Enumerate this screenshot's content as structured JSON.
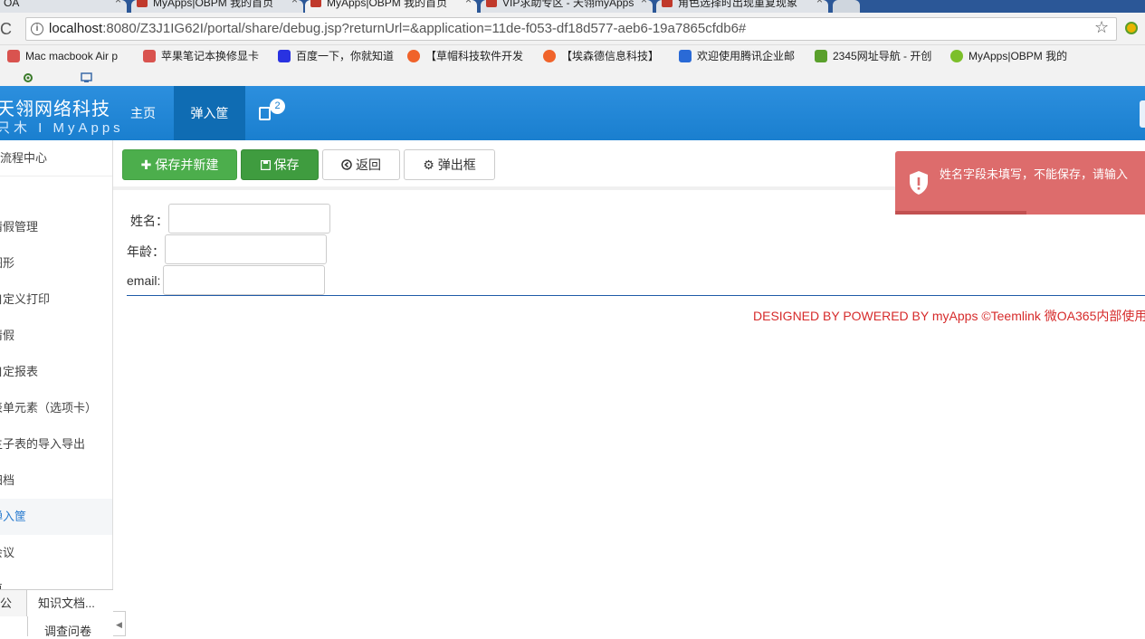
{
  "browser": {
    "tabs": [
      {
        "label": "OA",
        "close": "×"
      },
      {
        "label": "MyApps|OBPM 我的首页",
        "close": "×"
      },
      {
        "label": "MyApps|OBPM 我的首页",
        "close": "×"
      },
      {
        "label": "VIP求助专区 - 天翎myApps",
        "close": "×"
      },
      {
        "label": "角色选择时出现重复现象",
        "close": "×"
      }
    ],
    "url_host": "localhost",
    "url_rest": ":8080/Z3J1IG62I/portal/share/debug.jsp?returnUrl=&application=11de-f053-df18d577-aeb6-19a7865cfdb6#",
    "reload_glyph": "C",
    "info_glyph": "i",
    "star_glyph": "☆",
    "bookmarks": [
      {
        "label": "Mac macbook Air p",
        "color": "#d9534f"
      },
      {
        "label": "苹果笔记本换修显卡",
        "color": "#d9534f"
      },
      {
        "label": "百度一下，你就知道",
        "color": "#2932e1"
      },
      {
        "label": "【草帽科技软件开发",
        "color": "#f0632a"
      },
      {
        "label": "【埃森德信息科技】",
        "color": "#f0632a"
      },
      {
        "label": "欢迎使用腾讯企业邮",
        "color": "#2a6ad6"
      },
      {
        "label": "2345网址导航 - 开创",
        "color": "#5aa02c"
      },
      {
        "label": "MyApps|OBPM 我的",
        "color": "#7cbf2a"
      }
    ]
  },
  "header": {
    "brand": "天翎网络科技",
    "brand_sub": "只木 I MyApps",
    "nav_home": "主页",
    "nav_popup": "弹入筐",
    "msg_badge": "2"
  },
  "sidebar": {
    "items": [
      {
        "label": "流程中心",
        "active": false
      },
      {
        "label": "",
        "active": false
      },
      {
        "label": "请假管理",
        "active": false
      },
      {
        "label": "图形",
        "active": false
      },
      {
        "label": "自定义打印",
        "active": false
      },
      {
        "label": "请假",
        "active": false
      },
      {
        "label": "自定报表",
        "active": false
      },
      {
        "label": "表单元素（选项卡）",
        "active": false
      },
      {
        "label": "主子表的导入导出",
        "active": false
      },
      {
        "label": "归档",
        "active": false
      },
      {
        "label": "弹入筐",
        "active": true
      },
      {
        "label": "会议",
        "active": false
      },
      {
        "label": "車",
        "active": false
      }
    ],
    "tab_office": "公",
    "tab_knowledge": "知识文档...",
    "sub_survey": "调查问卷",
    "collapse_glyph": "◀"
  },
  "toolbar": {
    "save_new": "保存并新建",
    "save": "保存",
    "back": "返回",
    "popup": "弹出框"
  },
  "form": {
    "name_label": "姓名：",
    "name_value": "",
    "age_label": "年龄：",
    "age_value": "",
    "email_label": "email:",
    "email_value": ""
  },
  "footer": "DESIGNED BY POWERED BY myApps ©Teemlink 微OA365内部使用",
  "toast": {
    "message": "姓名字段未填写，不能保存，请输入"
  }
}
